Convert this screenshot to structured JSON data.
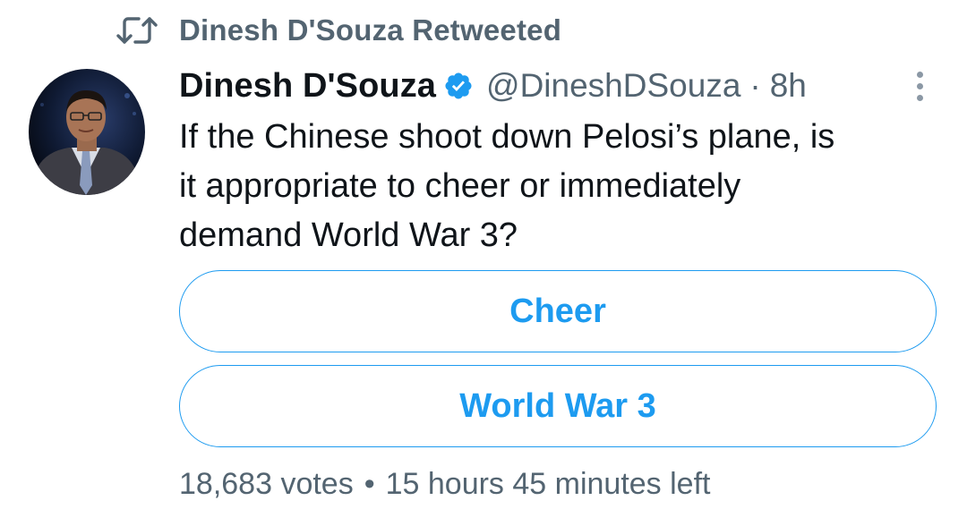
{
  "retweet_context": {
    "icon": "retweet-icon",
    "text": "Dinesh D'Souza Retweeted"
  },
  "author": {
    "display_name": "Dinesh D'Souza",
    "verified": true,
    "verified_color": "#1d9bf0",
    "handle": "@DineshDSouza",
    "separator": "·",
    "time": "8h",
    "avatar": "avatar-photo"
  },
  "tweet": {
    "lines": [
      "If the Chinese shoot down Pelosi’s plane, is",
      "it appropriate to cheer or immediately",
      "demand World War 3?"
    ]
  },
  "poll": {
    "options": [
      {
        "label": "Cheer"
      },
      {
        "label": "World War 3"
      }
    ],
    "votes": "18,683 votes",
    "bullet": "•",
    "time_left": "15 hours 45 minutes left",
    "accent_color": "#1d9bf0"
  },
  "menu": {
    "icon": "more-vertical-icon"
  }
}
